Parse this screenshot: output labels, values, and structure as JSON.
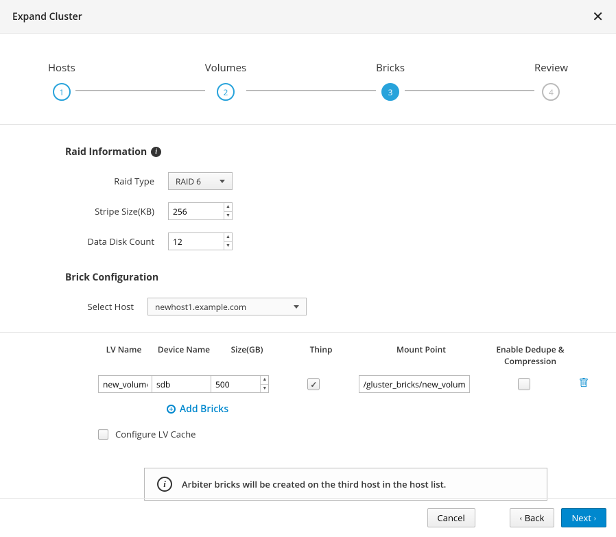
{
  "header": {
    "title": "Expand Cluster",
    "close_glyph": "✕"
  },
  "stepper": {
    "steps": [
      {
        "label": "Hosts",
        "num": "1",
        "state": "complete"
      },
      {
        "label": "Volumes",
        "num": "2",
        "state": "complete"
      },
      {
        "label": "Bricks",
        "num": "3",
        "state": "active"
      },
      {
        "label": "Review",
        "num": "4",
        "state": "upcoming"
      }
    ]
  },
  "raid": {
    "section_title": "Raid Information",
    "raid_type_label": "Raid Type",
    "raid_type_value": "RAID 6",
    "stripe_label": "Stripe Size(KB)",
    "stripe_value": "256",
    "disk_count_label": "Data Disk Count",
    "disk_count_value": "12"
  },
  "brick_config": {
    "section_title": "Brick Configuration",
    "select_host_label": "Select Host",
    "selected_host": "newhost1.example.com",
    "headers": {
      "lv_name": "LV Name",
      "device_name": "Device Name",
      "size": "Size(GB)",
      "thinp": "Thinp",
      "mount_point": "Mount Point",
      "dedupe": "Enable Dedupe & Compression"
    },
    "row": {
      "lv_name": "new_volume",
      "device_name": "sdb",
      "size": "500",
      "thinp_checked": true,
      "mount_point": "/gluster_bricks/new_volume",
      "dedupe_checked": false
    },
    "add_bricks_label": "Add Bricks",
    "configure_lv_cache_label": "Configure LV Cache",
    "info_text": "Arbiter bricks will be created on the third host in the host list."
  },
  "footer": {
    "cancel": "Cancel",
    "back": "Back",
    "next": "Next"
  },
  "icons": {
    "info": "i",
    "plus": "+",
    "chev_left": "‹",
    "chev_right": "›"
  }
}
